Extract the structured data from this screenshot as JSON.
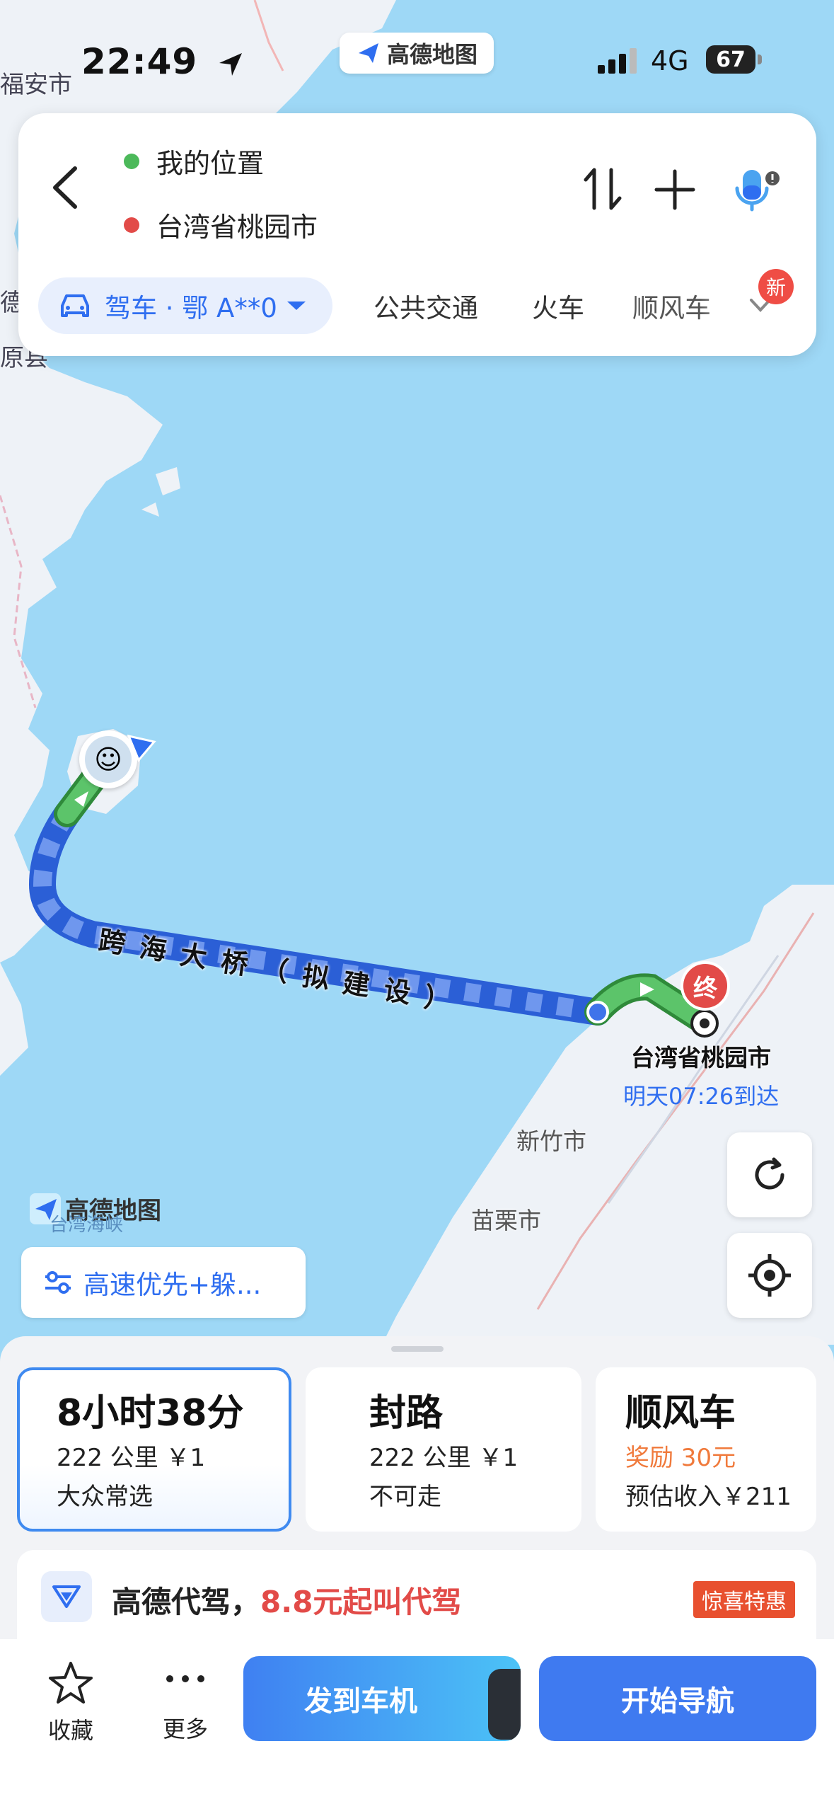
{
  "status_bar": {
    "time": "22:49",
    "app_badge": "高德地图",
    "network": "4G",
    "battery": "67"
  },
  "search_card": {
    "origin": "我的位置",
    "destination": "台湾省桃园市",
    "mode": "驾车 · 鄂 A**0",
    "tabs": [
      "公共交通",
      "火车",
      "顺风车"
    ],
    "new_badge": "新"
  },
  "map": {
    "left_labels": [
      "福安市",
      "德",
      "原县"
    ],
    "route_label_chars": [
      "跨",
      "海",
      "大",
      "桥",
      "（",
      "拟",
      "建",
      "设",
      "）"
    ],
    "destination_marker": "终",
    "destination_name": "台湾省桃园市",
    "eta": "明天07:26到达",
    "cities": [
      "新竹市",
      "苗栗市"
    ],
    "watermark": "高德地图",
    "strait_label": "台湾海峡",
    "pref_button": "高速优先+躲..."
  },
  "route_options": [
    {
      "title": "8小时38分",
      "line1": "222 公里  ￥1",
      "line2": "大众常选",
      "selected": true
    },
    {
      "title": "封路",
      "line1": "222 公里  ￥1",
      "line2": "不可走",
      "selected": false
    },
    {
      "title": "顺风车",
      "line1": "奖励 30元",
      "line2": "预估收入￥211",
      "selected": false
    }
  ],
  "promo": {
    "brand": "高德代驾，",
    "highlight": "8.8元起叫代驾",
    "tag": "惊喜特惠"
  },
  "bottom": {
    "fav": "收藏",
    "more": "更多",
    "send": "发到车机",
    "start": "开始导航"
  },
  "colors": {
    "accent": "#2f6ef0",
    "route_blue": "#3f73ea",
    "route_green": "#4cb95a",
    "dest_red": "#e24b48",
    "map_sea": "#9ed8f6"
  }
}
